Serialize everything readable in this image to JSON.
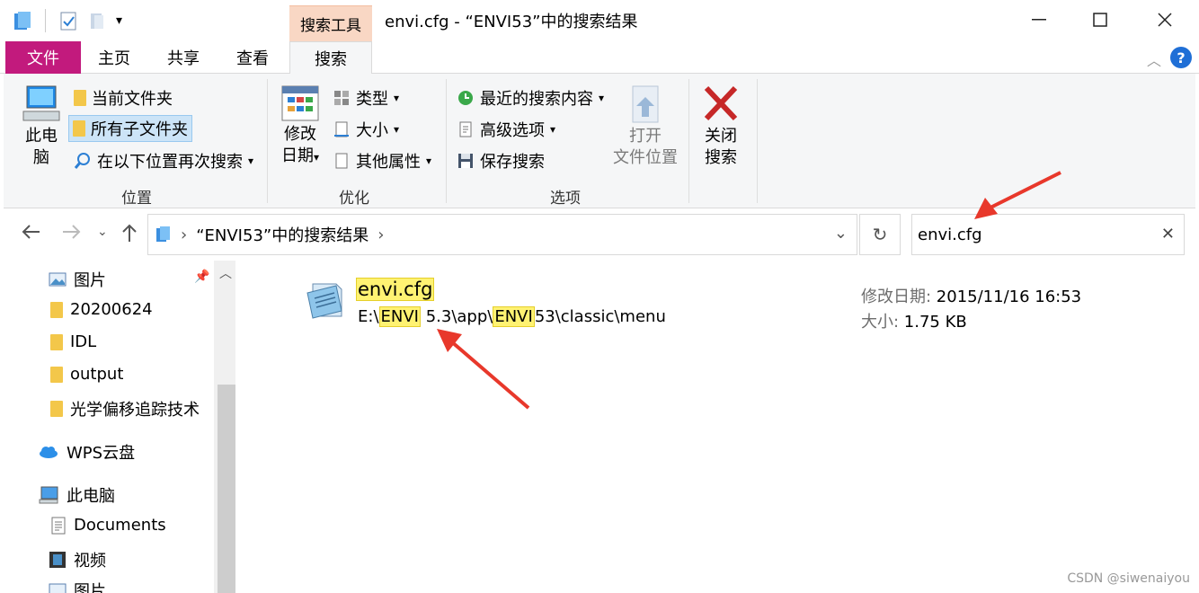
{
  "window": {
    "title": "envi.cfg - “ENVI53”中的搜索结果",
    "tool_tab": "搜索工具"
  },
  "ribbon_tabs": [
    {
      "label": "文件"
    },
    {
      "label": "主页"
    },
    {
      "label": "共享"
    },
    {
      "label": "查看"
    },
    {
      "label": "搜索"
    }
  ],
  "ribbon": {
    "location": {
      "this_pc_line1": "此电",
      "this_pc_line2": "脑",
      "current_folder": "当前文件夹",
      "all_subfolders": "所有子文件夹",
      "search_again": "在以下位置再次搜索",
      "label": "位置"
    },
    "refine": {
      "modified_line1": "修改",
      "modified_line2": "日期",
      "type": "类型",
      "size": "大小",
      "other_props": "其他属性",
      "label": "优化"
    },
    "options": {
      "recent_searches": "最近的搜索内容",
      "advanced": "高级选项",
      "save_search": "保存搜索",
      "open_location_line1": "打开",
      "open_location_line2": "文件位置",
      "label": "选项"
    },
    "close": {
      "line1": "关闭",
      "line2": "搜索"
    }
  },
  "address": {
    "path": "“ENVI53”中的搜索结果"
  },
  "search": {
    "value": "envi.cfg"
  },
  "nav_pane": {
    "items": [
      {
        "label": "图片"
      },
      {
        "label": "20200624"
      },
      {
        "label": "IDL"
      },
      {
        "label": "output"
      },
      {
        "label": "光学偏移追踪技术"
      },
      {
        "label": "WPS云盘"
      },
      {
        "label": "此电脑"
      },
      {
        "label": "Documents"
      },
      {
        "label": "视频"
      },
      {
        "label": "图片"
      }
    ]
  },
  "result": {
    "name": "envi.cfg",
    "path_prefix": "E:\\",
    "path_hl1": "ENVI",
    "path_mid": " 5.3\\app\\",
    "path_hl2": "ENVI",
    "path_suffix": "53\\classic\\menu",
    "modified_key": "修改日期: ",
    "modified_value": "2015/11/16 16:53",
    "size_key": "大小: ",
    "size_value": "1.75 KB"
  },
  "watermark": "CSDN @siwenaiyou",
  "colors": {
    "file_tab": "#c21a7d",
    "tool_tab": "#f9d7c4",
    "highlight": "#fff272",
    "annotation_arrow": "#e8382b"
  }
}
